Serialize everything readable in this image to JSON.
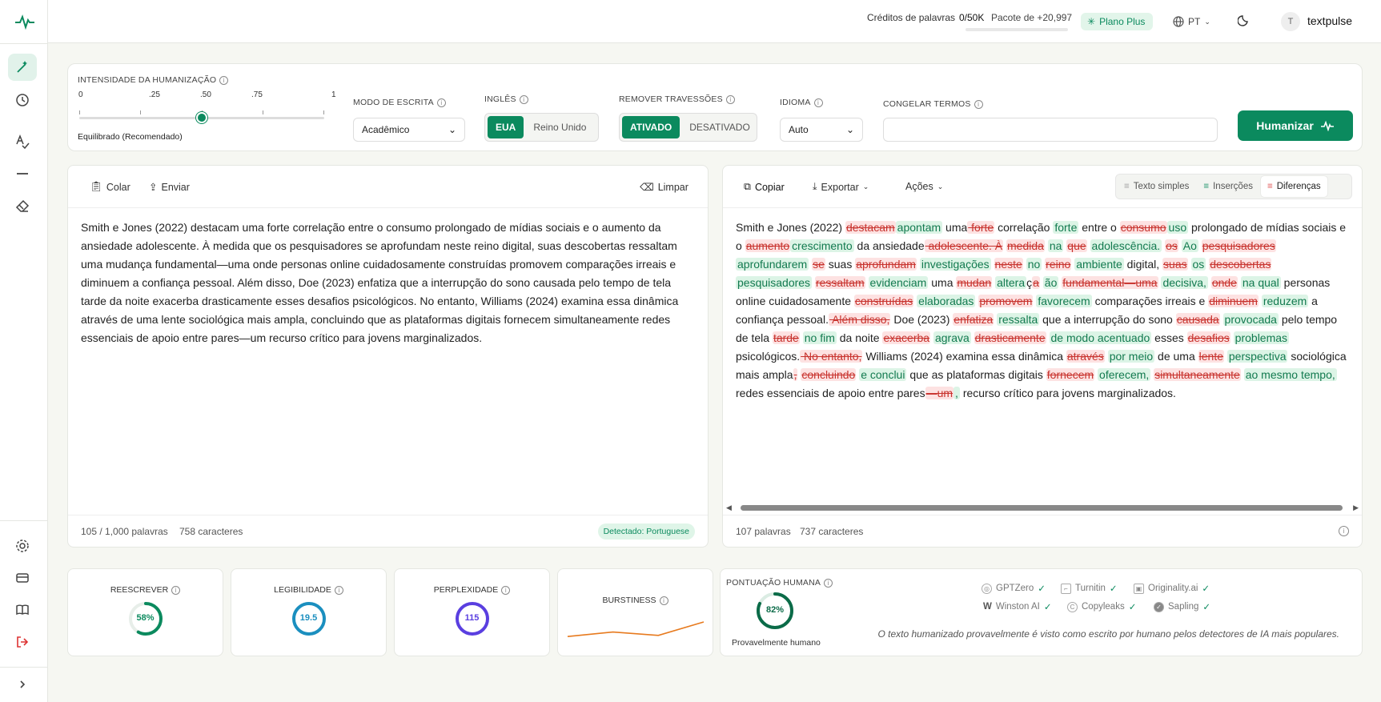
{
  "topbar": {
    "credits_label": "Créditos de palavras",
    "credits_value": "0/50K",
    "package": "Pacote de +20,997",
    "plan": "Plano Plus",
    "language": "PT",
    "avatar_initial": "T",
    "username": "textpulse"
  },
  "settings": {
    "intensity_label": "INTENSIDADE DA HUMANIZAÇÃO",
    "ticks": [
      "0",
      ".25",
      ".50",
      ".75",
      "1"
    ],
    "intensity_value": 0.5,
    "intensity_caption": "Equilibrado (Recomendado)",
    "mode_label": "MODO DE ESCRITA",
    "mode_value": "Acadêmico",
    "english_label": "INGLÊS",
    "english_us": "EUA",
    "english_uk": "Reino Unido",
    "dashes_label": "REMOVER TRAVESSÕES",
    "dashes_on": "ATIVADO",
    "dashes_off": "DESATIVADO",
    "language_label": "IDIOMA",
    "language_value": "Auto",
    "freeze_label": "CONGELAR TERMOS",
    "freeze_value": "",
    "humanize_button": "Humanizar"
  },
  "input_panel": {
    "paste": "Colar",
    "upload": "Enviar",
    "clear": "Limpar",
    "text": "Smith e Jones (2022) destacam uma forte correlação entre o consumo prolongado de mídias sociais e o aumento da ansiedade adolescente. À medida que os pesquisadores se aprofundam neste reino digital, suas descobertas ressaltam uma mudança fundamental—uma onde personas online cuidadosamente construídas promovem comparações irreais e diminuem a confiança pessoal. Além disso, Doe (2023) enfatiza que a interrupção do sono causada pelo tempo de tela tarde da noite exacerba drasticamente esses desafios psicológicos. No entanto, Williams (2024) examina essa dinâmica através de uma lente sociológica mais ampla, concluindo que as plataformas digitais fornecem simultaneamente redes essenciais de apoio entre pares—um recurso crítico para jovens marginalizados.",
    "word_count": "105 / 1,000 palavras",
    "char_count": "758 caracteres",
    "detected": "Detectado: Portuguese"
  },
  "output_panel": {
    "copy": "Copiar",
    "export": "Exportar",
    "actions": "Ações",
    "view_plain": "Texto simples",
    "view_insertions": "Inserções",
    "view_diff": "Diferenças",
    "word_count": "107 palavras",
    "char_count": "737 caracteres",
    "segments": [
      {
        "t": "n",
        "v": "Smith e Jones (2022) "
      },
      {
        "t": "d",
        "v": "destacam"
      },
      {
        "t": "i",
        "v": "apontam"
      },
      {
        "t": "n",
        "v": " uma"
      },
      {
        "t": "d",
        "v": " forte"
      },
      {
        "t": "n",
        "v": " correlação "
      },
      {
        "t": "i",
        "v": "forte"
      },
      {
        "t": "n",
        "v": " entre o "
      },
      {
        "t": "d",
        "v": "consumo"
      },
      {
        "t": "i",
        "v": "uso"
      },
      {
        "t": "n",
        "v": " prolongado de mídias sociais e o "
      },
      {
        "t": "d",
        "v": "aumento"
      },
      {
        "t": "i",
        "v": "crescimento"
      },
      {
        "t": "n",
        "v": " da ansiedade"
      },
      {
        "t": "d",
        "v": " adolescente. À"
      },
      {
        "t": "n",
        "v": " "
      },
      {
        "t": "d",
        "v": "medida"
      },
      {
        "t": "n",
        "v": " "
      },
      {
        "t": "i",
        "v": "na"
      },
      {
        "t": "n",
        "v": " "
      },
      {
        "t": "d",
        "v": "que"
      },
      {
        "t": "n",
        "v": " "
      },
      {
        "t": "i",
        "v": "adolescência."
      },
      {
        "t": "n",
        "v": " "
      },
      {
        "t": "d",
        "v": "os"
      },
      {
        "t": "n",
        "v": " "
      },
      {
        "t": "i",
        "v": "Ao"
      },
      {
        "t": "n",
        "v": " "
      },
      {
        "t": "d",
        "v": "pesquisadores"
      },
      {
        "t": "n",
        "v": " "
      },
      {
        "t": "i",
        "v": "aprofundarem"
      },
      {
        "t": "n",
        "v": " "
      },
      {
        "t": "d",
        "v": "se"
      },
      {
        "t": "n",
        "v": " suas "
      },
      {
        "t": "d",
        "v": "aprofundam"
      },
      {
        "t": "n",
        "v": " "
      },
      {
        "t": "i",
        "v": "investigações"
      },
      {
        "t": "n",
        "v": " "
      },
      {
        "t": "d",
        "v": "neste"
      },
      {
        "t": "n",
        "v": " "
      },
      {
        "t": "i",
        "v": "no"
      },
      {
        "t": "n",
        "v": " "
      },
      {
        "t": "d",
        "v": "reino"
      },
      {
        "t": "n",
        "v": " "
      },
      {
        "t": "i",
        "v": "ambiente"
      },
      {
        "t": "n",
        "v": " digital, "
      },
      {
        "t": "d",
        "v": "suas"
      },
      {
        "t": "n",
        "v": " "
      },
      {
        "t": "i",
        "v": "os"
      },
      {
        "t": "n",
        "v": " "
      },
      {
        "t": "d",
        "v": "descobertas"
      },
      {
        "t": "n",
        "v": " "
      },
      {
        "t": "i",
        "v": "pesquisadores"
      },
      {
        "t": "n",
        "v": " "
      },
      {
        "t": "d",
        "v": "ressaltam"
      },
      {
        "t": "n",
        "v": " "
      },
      {
        "t": "i",
        "v": "evidenciam"
      },
      {
        "t": "n",
        "v": " uma "
      },
      {
        "t": "d",
        "v": "mudan"
      },
      {
        "t": "n",
        "v": " "
      },
      {
        "t": "i",
        "v": "altera"
      },
      {
        "t": "n",
        "v": "ç"
      },
      {
        "t": "d",
        "v": "a"
      },
      {
        "t": "n",
        "v": " "
      },
      {
        "t": "i",
        "v": "ão"
      },
      {
        "t": "n",
        "v": " "
      },
      {
        "t": "d",
        "v": "fundamental—uma"
      },
      {
        "t": "n",
        "v": " "
      },
      {
        "t": "i",
        "v": "decisiva,"
      },
      {
        "t": "n",
        "v": " "
      },
      {
        "t": "d",
        "v": "onde"
      },
      {
        "t": "n",
        "v": " "
      },
      {
        "t": "i",
        "v": "na qual"
      },
      {
        "t": "n",
        "v": " personas online cuidadosamente "
      },
      {
        "t": "d",
        "v": "construídas"
      },
      {
        "t": "n",
        "v": " "
      },
      {
        "t": "i",
        "v": "elaboradas"
      },
      {
        "t": "n",
        "v": " "
      },
      {
        "t": "d",
        "v": "promovem"
      },
      {
        "t": "n",
        "v": " "
      },
      {
        "t": "i",
        "v": "favorecem"
      },
      {
        "t": "n",
        "v": " comparações irreais e "
      },
      {
        "t": "d",
        "v": "diminuem"
      },
      {
        "t": "n",
        "v": " "
      },
      {
        "t": "i",
        "v": "reduzem"
      },
      {
        "t": "n",
        "v": " a confiança pessoal."
      },
      {
        "t": "d",
        "v": " Além disso,"
      },
      {
        "t": "n",
        "v": " Doe (2023) "
      },
      {
        "t": "d",
        "v": "enfatiza"
      },
      {
        "t": "n",
        "v": " "
      },
      {
        "t": "i",
        "v": "ressalta"
      },
      {
        "t": "n",
        "v": " que a interrupção do sono "
      },
      {
        "t": "d",
        "v": "causada"
      },
      {
        "t": "n",
        "v": " "
      },
      {
        "t": "i",
        "v": "provocada"
      },
      {
        "t": "n",
        "v": " pelo tempo de tela "
      },
      {
        "t": "d",
        "v": "tarde"
      },
      {
        "t": "n",
        "v": " "
      },
      {
        "t": "i",
        "v": "no fim"
      },
      {
        "t": "n",
        "v": " da noite "
      },
      {
        "t": "d",
        "v": "exacerba"
      },
      {
        "t": "n",
        "v": " "
      },
      {
        "t": "i",
        "v": "agrava"
      },
      {
        "t": "n",
        "v": " "
      },
      {
        "t": "d",
        "v": "drasticamente"
      },
      {
        "t": "n",
        "v": " "
      },
      {
        "t": "i",
        "v": "de modo acentuado"
      },
      {
        "t": "n",
        "v": " esses "
      },
      {
        "t": "d",
        "v": "desafios"
      },
      {
        "t": "n",
        "v": " "
      },
      {
        "t": "i",
        "v": "problemas"
      },
      {
        "t": "n",
        "v": " psicológicos."
      },
      {
        "t": "d",
        "v": " No entanto,"
      },
      {
        "t": "n",
        "v": " Williams (2024) examina essa dinâmica "
      },
      {
        "t": "d",
        "v": "através"
      },
      {
        "t": "n",
        "v": " "
      },
      {
        "t": "i",
        "v": "por meio"
      },
      {
        "t": "n",
        "v": " de uma "
      },
      {
        "t": "d",
        "v": "lente"
      },
      {
        "t": "n",
        "v": " "
      },
      {
        "t": "i",
        "v": "perspectiva"
      },
      {
        "t": "n",
        "v": " sociológica mais ampla"
      },
      {
        "t": "d",
        "v": ","
      },
      {
        "t": "n",
        "v": " "
      },
      {
        "t": "d",
        "v": "concluindo"
      },
      {
        "t": "n",
        "v": " "
      },
      {
        "t": "i",
        "v": "e conclui"
      },
      {
        "t": "n",
        "v": " que as plataformas digitais "
      },
      {
        "t": "d",
        "v": "fornecem"
      },
      {
        "t": "n",
        "v": " "
      },
      {
        "t": "i",
        "v": "oferecem,"
      },
      {
        "t": "n",
        "v": " "
      },
      {
        "t": "d",
        "v": "simultaneamente"
      },
      {
        "t": "n",
        "v": " "
      },
      {
        "t": "i",
        "v": "ao mesmo tempo,"
      },
      {
        "t": "n",
        "v": " redes essenciais de apoio entre pares"
      },
      {
        "t": "d",
        "v": "—um"
      },
      {
        "t": "i",
        "v": ","
      },
      {
        "t": "n",
        "v": " recurso crítico para jovens marginalizados."
      }
    ]
  },
  "metrics": {
    "rewrite_label": "REESCREVER",
    "rewrite_value": "58%",
    "rewrite_pct": 58,
    "readability_label": "LEGIBILIDADE",
    "readability_value": "19.5",
    "perplexity_label": "PERPLEXIDADE",
    "perplexity_value": "115",
    "burstiness_label": "BURSTINESS",
    "burstiness_points": [
      0.35,
      0.55,
      0.4,
      1.0
    ],
    "human_label": "PONTUAÇÃO HUMANA",
    "human_value": "82%",
    "human_pct": 82,
    "human_caption": "Provavelmente humano",
    "detectors": [
      "GPTZero",
      "Turnitin",
      "Originality.ai",
      "Winston AI",
      "Copyleaks",
      "Sapling"
    ],
    "human_note": "O texto humanizado provavelmente é visto como escrito por humano pelos detectores de IA mais populares.",
    "colors": {
      "accent": "#0b8a5e",
      "readability": "#1b8fbf",
      "perplexity": "#5a3fe0",
      "burstiness": "#e77a1e"
    }
  }
}
